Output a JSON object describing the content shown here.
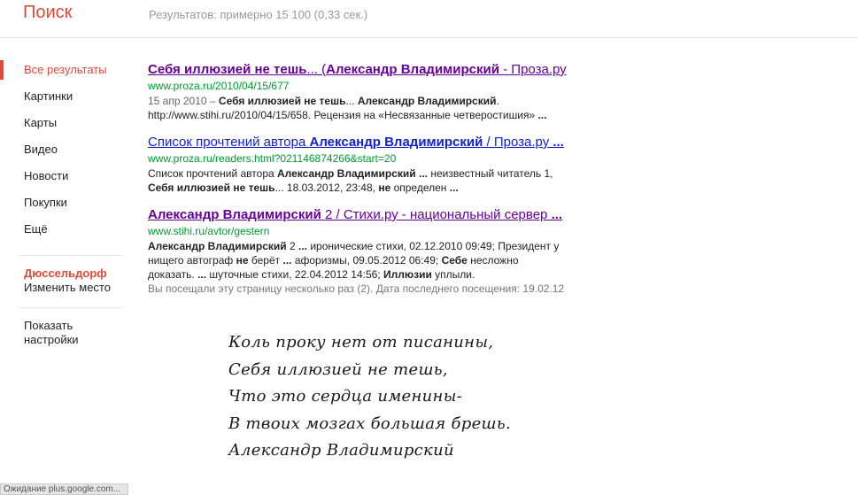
{
  "header": {
    "title": "Поиск",
    "stats": "Результатов: примерно 15 100 (0,33 сек.)"
  },
  "sidebar": {
    "items": [
      {
        "label": "Все результаты",
        "active": true
      },
      {
        "label": "Картинки"
      },
      {
        "label": "Карты"
      },
      {
        "label": "Видео"
      },
      {
        "label": "Новости"
      },
      {
        "label": "Покупки"
      },
      {
        "label": "Ещё"
      }
    ],
    "location": {
      "city": "Дюссельдорф",
      "change": "Изменить место"
    },
    "settings": "Показать настройки"
  },
  "results": [
    {
      "title_parts": [
        {
          "t": "Себя иллюзией не тешь",
          "b": true
        },
        {
          "t": "... ("
        },
        {
          "t": "Александр Владимирский",
          "b": true
        },
        {
          "t": " - Проза.ру"
        }
      ],
      "visited": true,
      "url": "www.proza.ru/2010/04/15/677",
      "snippet_lines": [
        [
          {
            "t": "15 апр 2010 – ",
            "d": true
          },
          {
            "t": "Себя иллюзией не тешь",
            "b": true
          },
          {
            "t": "... "
          },
          {
            "t": "Александр Владимирский",
            "b": true
          },
          {
            "t": "."
          }
        ],
        [
          {
            "t": "http://www.stihi.ru/2010/04/15/658. Рецензия на «Несвязанные четверостишия» "
          },
          {
            "t": "...",
            "b": true
          }
        ]
      ]
    },
    {
      "title_parts": [
        {
          "t": "Список прочтений автора "
        },
        {
          "t": "Александр Владимирский",
          "b": true
        },
        {
          "t": " / Проза.ру "
        },
        {
          "t": "...",
          "b": true
        }
      ],
      "visited": false,
      "url": "www.proza.ru/readers.html?021146874266&start=20",
      "snippet_lines": [
        [
          {
            "t": "Список прочтений автора "
          },
          {
            "t": "Александр Владимирский ...",
            "b": true
          },
          {
            "t": " неизвестный читатель 1,"
          }
        ],
        [
          {
            "t": "Себя иллюзией не тешь",
            "b": true
          },
          {
            "t": "... 18.03.2012, 23:48, "
          },
          {
            "t": "не",
            "b": true
          },
          {
            "t": " определен "
          },
          {
            "t": "...",
            "b": true
          }
        ]
      ]
    },
    {
      "title_parts": [
        {
          "t": "Александр Владимирский",
          "b": true
        },
        {
          "t": " 2 / Стихи.ру - национальный сервер "
        },
        {
          "t": "...",
          "b": true
        }
      ],
      "visited": true,
      "url": "www.stihi.ru/avtor/gestern",
      "snippet_lines": [
        [
          {
            "t": "Александр Владимирский",
            "b": true
          },
          {
            "t": " 2 "
          },
          {
            "t": "...",
            "b": true
          },
          {
            "t": " иронические стихи, 02.12.2010 09:49; Президент у"
          }
        ],
        [
          {
            "t": "нищего автограф "
          },
          {
            "t": "не",
            "b": true
          },
          {
            "t": " берёт "
          },
          {
            "t": "...",
            "b": true
          },
          {
            "t": " афоризмы, 09.05.2012 06:49; "
          },
          {
            "t": "Себе",
            "b": true
          },
          {
            "t": " несложно"
          }
        ],
        [
          {
            "t": "доказать. "
          },
          {
            "t": "...",
            "b": true
          },
          {
            "t": " шуточные стихи, 22.04.2012 14:56; "
          },
          {
            "t": "Иллюзии",
            "b": true
          },
          {
            "t": " уплыли."
          }
        ]
      ],
      "visit_info": "Вы посещали эту страницу несколько раз (2). Дата последнего посещения: 19.02.12"
    }
  ],
  "poem": [
    "Коль проку нет от писанины,",
    "Себя иллюзией не тешь,",
    "Что это сердца именины-",
    "В твоих мозгах большая брешь.",
    "Александр Владимирский"
  ],
  "status_bar": "Ожидание plus.google.com...",
  "colors": {
    "brand": "#dd4b39",
    "link_visited": "#660099",
    "link": "#1122cc",
    "url": "#009933"
  }
}
